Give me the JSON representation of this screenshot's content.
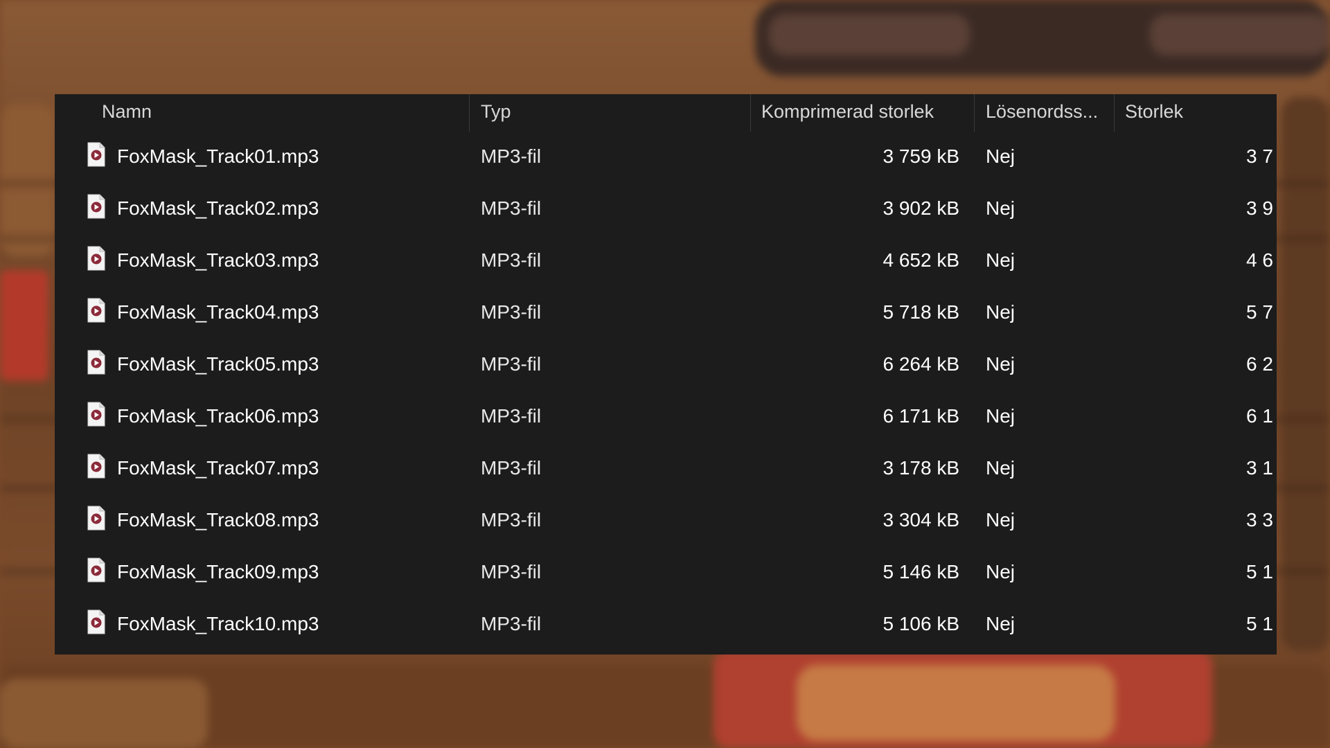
{
  "columns": {
    "name": "Namn",
    "type": "Typ",
    "compressed": "Komprimerad storlek",
    "password": "Lösenordss...",
    "size": "Storlek"
  },
  "files": [
    {
      "name": "FoxMask_Track01.mp3",
      "type": "MP3-fil",
      "compressed": "3 759 kB",
      "password": "Nej",
      "size": "3 7"
    },
    {
      "name": "FoxMask_Track02.mp3",
      "type": "MP3-fil",
      "compressed": "3 902 kB",
      "password": "Nej",
      "size": "3 9"
    },
    {
      "name": "FoxMask_Track03.mp3",
      "type": "MP3-fil",
      "compressed": "4 652 kB",
      "password": "Nej",
      "size": "4 6"
    },
    {
      "name": "FoxMask_Track04.mp3",
      "type": "MP3-fil",
      "compressed": "5 718 kB",
      "password": "Nej",
      "size": "5 7"
    },
    {
      "name": "FoxMask_Track05.mp3",
      "type": "MP3-fil",
      "compressed": "6 264 kB",
      "password": "Nej",
      "size": "6 2"
    },
    {
      "name": "FoxMask_Track06.mp3",
      "type": "MP3-fil",
      "compressed": "6 171 kB",
      "password": "Nej",
      "size": "6 1"
    },
    {
      "name": "FoxMask_Track07.mp3",
      "type": "MP3-fil",
      "compressed": "3 178 kB",
      "password": "Nej",
      "size": "3 1"
    },
    {
      "name": "FoxMask_Track08.mp3",
      "type": "MP3-fil",
      "compressed": "3 304 kB",
      "password": "Nej",
      "size": "3 3"
    },
    {
      "name": "FoxMask_Track09.mp3",
      "type": "MP3-fil",
      "compressed": "5 146 kB",
      "password": "Nej",
      "size": "5 1"
    },
    {
      "name": "FoxMask_Track10.mp3",
      "type": "MP3-fil",
      "compressed": "5 106 kB",
      "password": "Nej",
      "size": "5 1"
    }
  ],
  "icons": {
    "file": "audio-file-icon"
  },
  "colors": {
    "panel_bg": "#1c1c1c",
    "text": "#ffffff",
    "header_text": "#d8d8d8",
    "icon_accent": "#8b2a3a"
  }
}
